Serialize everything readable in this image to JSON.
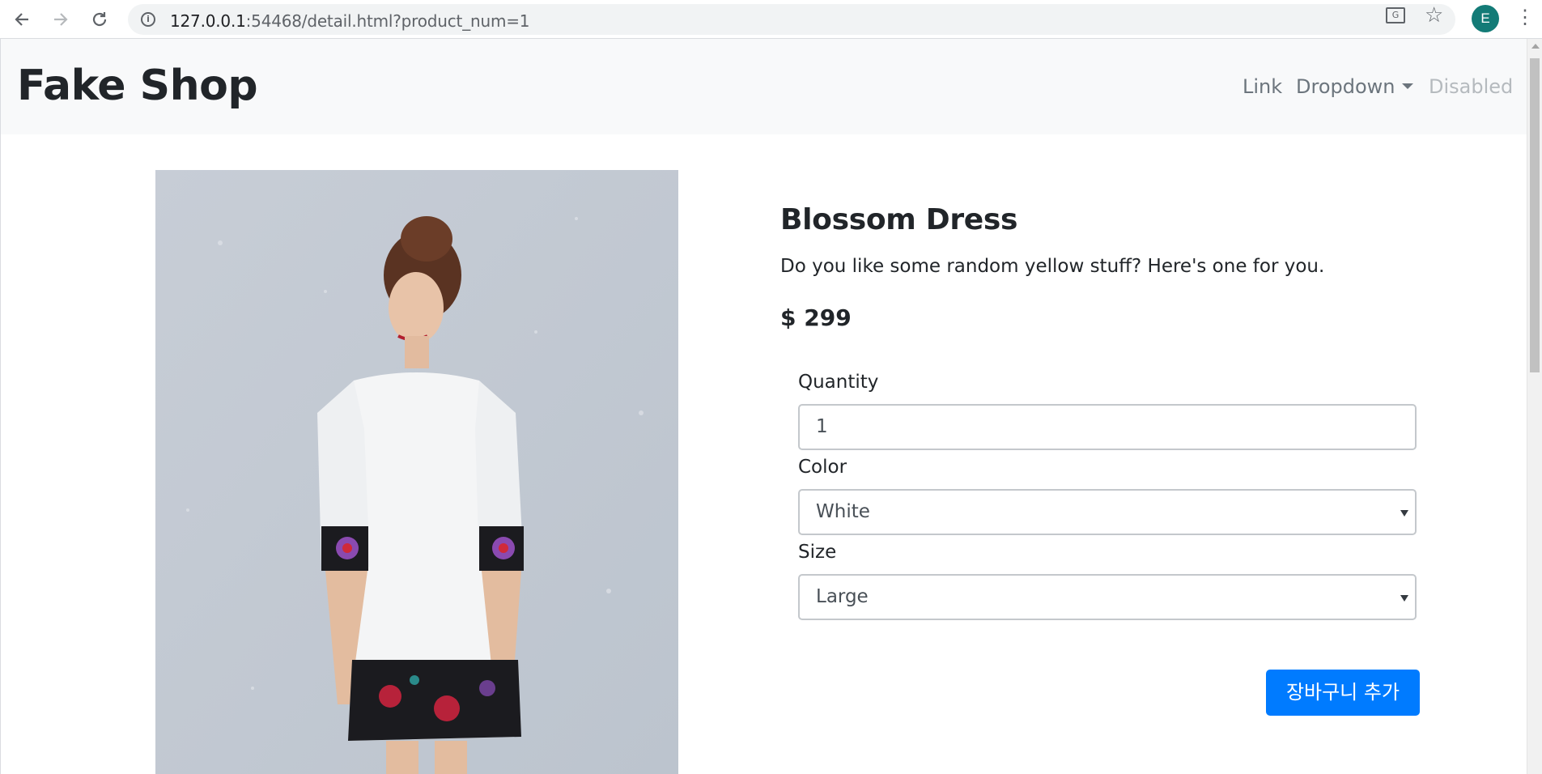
{
  "browser": {
    "url_host": "127.0.0.1",
    "url_rest": ":54468/detail.html?product_num=1",
    "avatar_letter": "E",
    "icons": {
      "back": "back-arrow-icon",
      "forward": "forward-arrow-icon",
      "reload": "reload-icon",
      "info": "info-icon",
      "translate": "translate-icon",
      "bookmark": "star-icon",
      "menu": "kebab-menu-icon"
    }
  },
  "navbar": {
    "brand": "Fake Shop",
    "links": {
      "link": "Link",
      "dropdown": "Dropdown",
      "disabled": "Disabled"
    }
  },
  "product": {
    "name": "Blossom Dress",
    "description": "Do you like some random yellow stuff? Here's one for you.",
    "price": "$ 299",
    "image_alt": "Blossom Dress"
  },
  "form": {
    "quantity_label": "Quantity",
    "quantity_value": "1",
    "color_label": "Color",
    "color_value": "White",
    "size_label": "Size",
    "size_value": "Large",
    "add_button": "장바구니 추가"
  },
  "colors": {
    "primary": "#007bff",
    "navbar_bg": "#f8f9fa",
    "text": "#212529",
    "avatar": "#137b77"
  }
}
